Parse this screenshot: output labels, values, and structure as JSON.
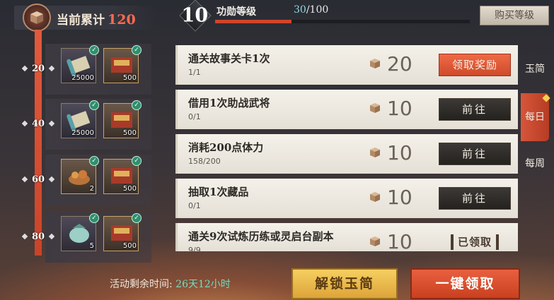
{
  "accumulated": {
    "label": "当前累计",
    "value": "120"
  },
  "level": {
    "number": "10",
    "label": "功勋等级",
    "current": "30",
    "max": "/100",
    "progress_fraction": 0.3,
    "buy_label": "购买等级"
  },
  "tiers": [
    {
      "marker": "20",
      "rewards": [
        {
          "icon": "scroll-icon",
          "amount": "25000",
          "claimed": true
        },
        {
          "icon": "book-chest-icon",
          "amount": "500",
          "claimed": true
        }
      ]
    },
    {
      "marker": "40",
      "rewards": [
        {
          "icon": "scroll-icon",
          "amount": "25000",
          "claimed": true
        },
        {
          "icon": "book-chest-icon",
          "amount": "500",
          "claimed": true
        }
      ]
    },
    {
      "marker": "60",
      "rewards": [
        {
          "icon": "food-basket-icon",
          "amount": "2",
          "claimed": true
        },
        {
          "icon": "book-chest-icon",
          "amount": "500",
          "claimed": true
        }
      ]
    },
    {
      "marker": "80",
      "rewards": [
        {
          "icon": "jade-pouch-icon",
          "amount": "5",
          "claimed": true
        },
        {
          "icon": "book-chest-icon",
          "amount": "500",
          "claimed": true
        }
      ]
    }
  ],
  "tasks": [
    {
      "title": "通关故事关卡1次",
      "progress": "1/1",
      "points": "20",
      "button": "领取奖励",
      "state": "claim"
    },
    {
      "title": "借用1次助战武将",
      "progress": "0/1",
      "points": "10",
      "button": "前往",
      "state": "goto"
    },
    {
      "title": "消耗200点体力",
      "progress": "158/200",
      "points": "10",
      "button": "前往",
      "state": "goto"
    },
    {
      "title": "抽取1次藏品",
      "progress": "0/1",
      "points": "10",
      "button": "前往",
      "state": "goto"
    },
    {
      "title": "通关9次试炼历练或灵启台副本",
      "progress": "9/9",
      "points": "10",
      "button": "已领取",
      "state": "done"
    }
  ],
  "tabs": [
    {
      "label": "玉简",
      "active": false
    },
    {
      "label": "每日",
      "active": true
    },
    {
      "label": "每周",
      "active": false
    }
  ],
  "remaining": {
    "label": "活动剩余时间:",
    "value": "26天12小时"
  },
  "buttons": {
    "unlock": "解锁玉简",
    "claim_all": "一键领取"
  },
  "colors": {
    "accent_red": "#d6563a",
    "gold": "#f6cf60",
    "teal": "#6de0c4"
  }
}
